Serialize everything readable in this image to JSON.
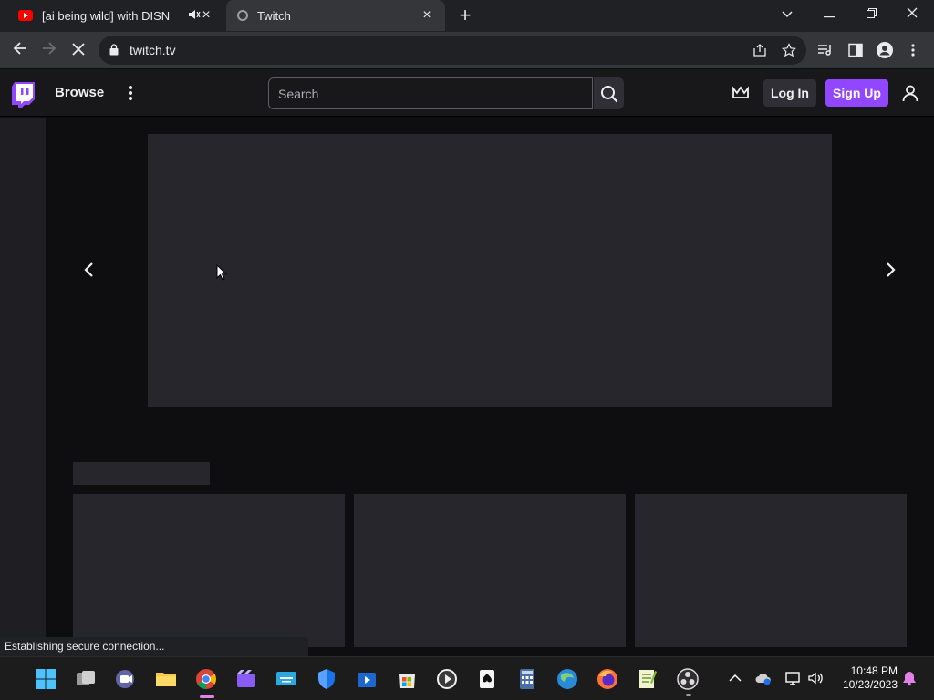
{
  "browser": {
    "tabs": [
      {
        "title": "[ai being wild] with DISNEY-",
        "active": false,
        "icon": "youtube-icon"
      },
      {
        "title": "Twitch",
        "active": true,
        "icon": "twitch-loading-icon"
      }
    ],
    "url": "twitch.tv",
    "status_text": "Establishing secure connection..."
  },
  "twitch": {
    "nav": {
      "browse_label": "Browse",
      "search_placeholder": "Search",
      "login_label": "Log In",
      "signup_label": "Sign Up"
    },
    "colors": {
      "brand": "#9147ff",
      "background": "#0e0e10",
      "nav_bg": "#18181b",
      "skeleton": "#26262c"
    }
  },
  "taskbar": {
    "time": "10:48 PM",
    "date": "10/23/2023"
  }
}
